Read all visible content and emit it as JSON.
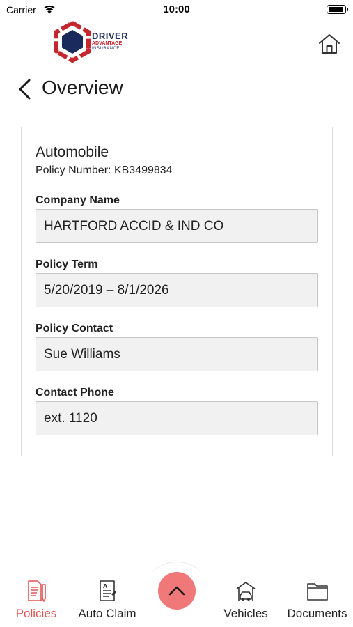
{
  "status_bar": {
    "carrier": "Carrier",
    "time": "10:00",
    "icons": [
      "wifi-icon",
      "battery-icon"
    ]
  },
  "header": {
    "logo": {
      "line1": "DRIVER",
      "line2": "ADVANTAGE",
      "line3": "INSURANCE"
    },
    "home_icon": "home-icon",
    "back_icon": "chevron-left-icon",
    "title": "Overview"
  },
  "policy": {
    "type": "Automobile",
    "number_label": "Policy Number:",
    "number": "KB3499834",
    "fields": [
      {
        "label": "Company Name",
        "value": "HARTFORD ACCID & IND CO"
      },
      {
        "label": "Policy Term",
        "value": "5/20/2019 – 8/1/2026"
      },
      {
        "label": "Policy Contact",
        "value": "Sue Williams"
      },
      {
        "label": "Contact Phone",
        "value": "ext. 1120"
      }
    ]
  },
  "tabbar": {
    "tabs": [
      {
        "label": "Policies",
        "icon": "policy-document-icon",
        "active": true
      },
      {
        "label": "Auto Claim",
        "icon": "claim-form-icon",
        "active": false
      },
      {
        "label": "Vehicles",
        "icon": "garage-car-icon",
        "active": false
      },
      {
        "label": "Documents",
        "icon": "folder-icon",
        "active": false
      }
    ],
    "fab_icon": "chevron-up-icon"
  },
  "colors": {
    "accent": "#e25454",
    "fab": "#f07878",
    "brand_navy": "#1b2a5c",
    "brand_red": "#c4272e",
    "field_bg": "#f1f1f2"
  }
}
